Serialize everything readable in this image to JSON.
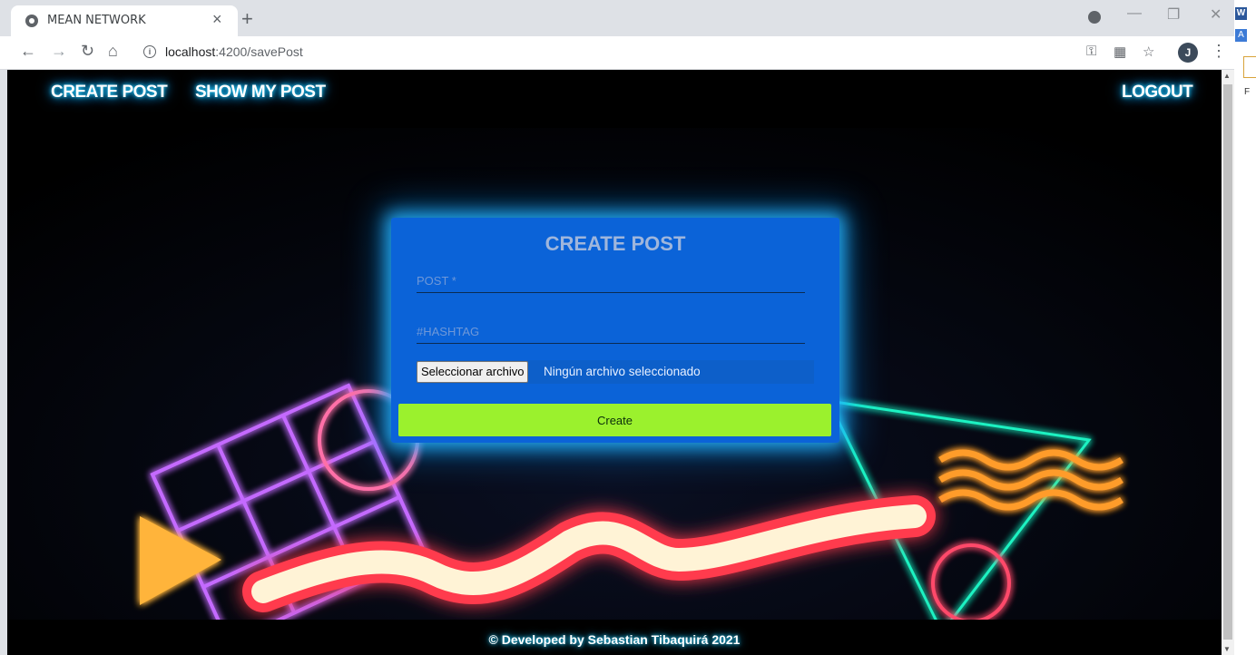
{
  "browser": {
    "tab_title": "MEAN NETWORK",
    "tab_close": "×",
    "new_tab": "+",
    "url_host": "localhost",
    "url_rest": ":4200/savePost",
    "avatar_letter": "J",
    "window_minimize": "—",
    "window_restore": "❐",
    "window_close": "✕"
  },
  "nav": {
    "create_post": "CREATE POST",
    "show_my_post": "SHOW MY POST",
    "logout": "LOGOUT"
  },
  "form": {
    "title": "CREATE POST",
    "post_placeholder": "POST *",
    "hashtag_placeholder": "#HASHTAG",
    "file_button": "Seleccionar archivo",
    "file_status": "Ningún archivo seleccionado",
    "submit_label": "Create"
  },
  "footer": {
    "text": "© Developed by Sebastian Tibaquirá 2021"
  },
  "side_window": {
    "w_label": "W",
    "a_label": "A",
    "f_label": "F"
  },
  "colors": {
    "card": "#0b63d8",
    "submit": "#9bf12d",
    "glow": "#00b7ff",
    "page_bg": "#000000"
  }
}
